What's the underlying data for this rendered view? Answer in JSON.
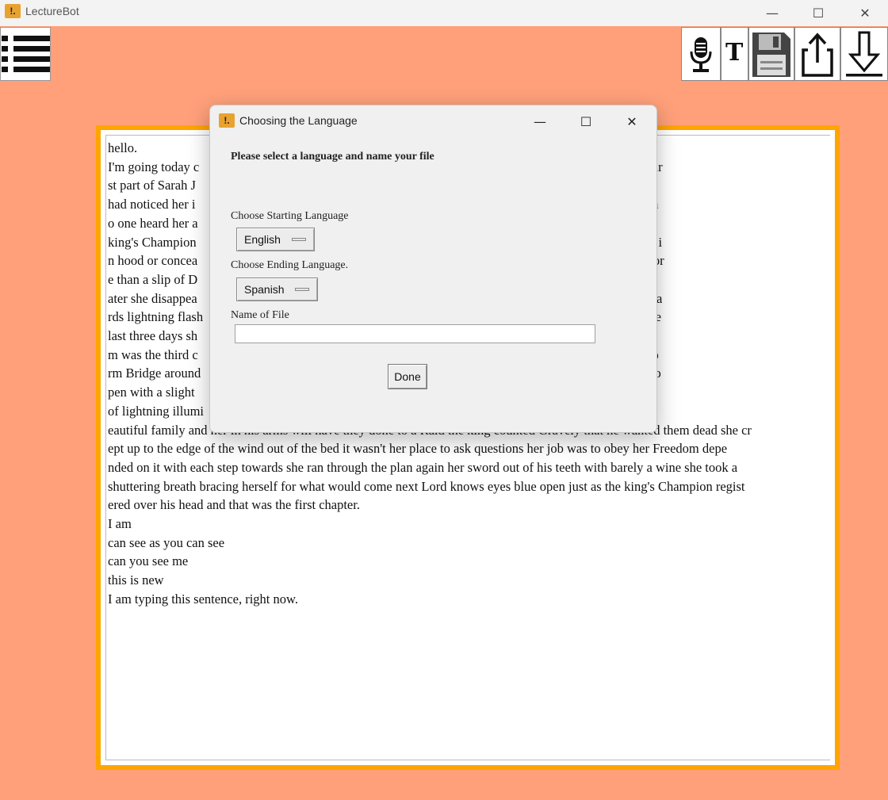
{
  "window": {
    "title": "LectureBot",
    "icon_glyph": "!.",
    "minimize_glyph": "—",
    "maximize_glyph": "☐",
    "close_glyph": "✕"
  },
  "toolbar": {
    "menu_icon": "list-menu-icon",
    "text_button_label": "T",
    "buttons": [
      "microphone-icon",
      "text-icon",
      "floppy-save-icon",
      "share-upload-icon",
      "download-arrow-icon"
    ]
  },
  "editor": {
    "content": "hello.\nI'm going today c                                                                                              m going to read is the very fir\nst part of Sarah J                                                                                              only sign of her entry no one\nhad noticed her i                                                                                               ing wind off the nearby sea n\no one heard her a                                                                                               the second floor hallway the\nking's Champion                                                                                                 th as black as a black mask i\nn hood or concea                                                                                                dows to become nothing mor\ne than a slip of D                                                                                              had she watched it seconds l\nater she disappea                                                                                               hat for Prince on the floorboa\nrds lightning flash                                                                                             taking only memorized in the\nlast three days sh                                                                                              ch side Lorde Royals bedroo\nm was the third c                                                                                               he house remained as the sto\nrm Bridge around                                                                                                ryl's bedroom door swung o\npen with a slight                                                                                               hut behind her another flash\nof lightning illumi                                                                                             and his wife dark hair and b\neautiful family and her in his arms will have they done to a Raid the king counted Gravely that he wanted them dead she cr\nept up to the edge of the wind out of the bed it wasn't her place to ask questions her job was to obey her Freedom depe\nnded on it with each step towards she ran through the plan again her sword out of his teeth with barely a wine she took a\nshuttering breath bracing herself for what would come next Lord knows eyes blue open just as the king's Champion regist\nered over his head and that was the first chapter.\nI am\ncan see as you can see\ncan you see me\nthis is new\nI am typing this sentence, right now."
  },
  "dialog": {
    "title": "Choosing the Language",
    "icon_glyph": "!.",
    "minimize_glyph": "—",
    "maximize_glyph": "☐",
    "close_glyph": "✕",
    "instruction": "Please select a language and name your file",
    "start_label": "Choose Starting Language",
    "start_value": "English",
    "end_label": "Choose Ending Language.",
    "end_value": "Spanish",
    "file_label": "Name of File",
    "file_value": "",
    "done_label": "Done"
  },
  "colors": {
    "background": "#ffa07a",
    "frame_border": "#ffa500",
    "titlebar": "#f3f3f3",
    "dialog_bg": "#f0f0f0"
  }
}
